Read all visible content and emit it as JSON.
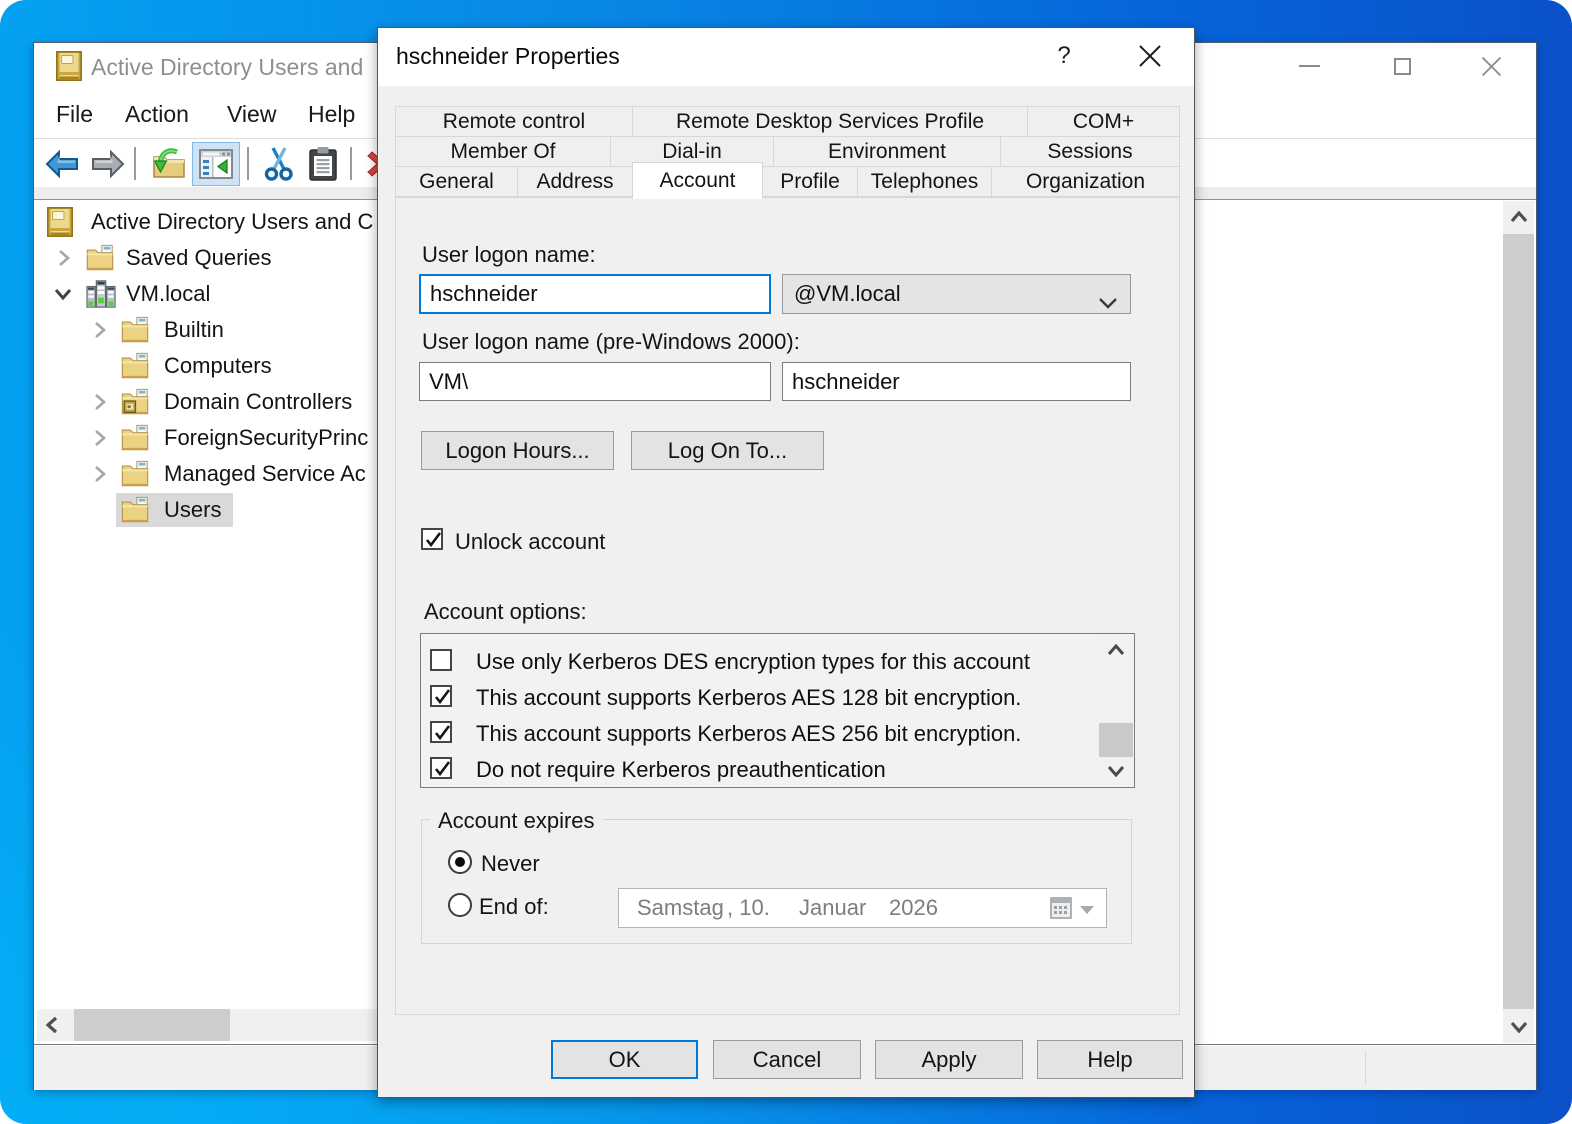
{
  "colors": {
    "desktop_gradient_start": "#16a2ef",
    "desktop_gradient_end": "#0a4ecd",
    "accent_focus_border": "#0078d7",
    "tree_selection": "#d9d9d9",
    "toolbar_toggle_highlight": "#cfe3f6"
  },
  "main_window": {
    "title": "Active Directory Users and",
    "caption_icons": [
      "minimize",
      "maximize",
      "close"
    ],
    "menu_items": [
      "File",
      "Action",
      "View",
      "Help"
    ],
    "toolbar_icon_names": [
      "back",
      "forward",
      "export-list",
      "show-console-tree",
      "cut",
      "paste",
      "delete"
    ],
    "tree": {
      "items": [
        {
          "label": "Active Directory Users and C",
          "level": 0,
          "icon": "directory-book",
          "expander": "none",
          "selected": false
        },
        {
          "label": "Saved Queries",
          "level": 1,
          "icon": "folder",
          "expander": "collapsed",
          "selected": false
        },
        {
          "label": "VM.local",
          "level": 1,
          "icon": "domain",
          "expander": "expanded",
          "selected": false
        },
        {
          "label": "Builtin",
          "level": 2,
          "icon": "folder",
          "expander": "collapsed",
          "selected": false
        },
        {
          "label": "Computers",
          "level": 2,
          "icon": "folder",
          "expander": "none",
          "selected": false
        },
        {
          "label": "Domain Controllers",
          "level": 2,
          "icon": "folder-dc",
          "expander": "collapsed",
          "selected": false
        },
        {
          "label": "ForeignSecurityPrinc",
          "level": 2,
          "icon": "folder",
          "expander": "collapsed",
          "selected": false
        },
        {
          "label": "Managed Service Ac",
          "level": 2,
          "icon": "folder",
          "expander": "collapsed",
          "selected": false
        },
        {
          "label": "Users",
          "level": 2,
          "icon": "folder",
          "expander": "none",
          "selected": true
        }
      ]
    }
  },
  "dialog": {
    "title": "hschneider Properties",
    "titlebar_icons": [
      "help",
      "close"
    ],
    "help_glyph": "?",
    "close_glyph": "✕",
    "tabs": [
      {
        "label": "Remote control",
        "row": 1,
        "active": false
      },
      {
        "label": "Remote Desktop Services Profile",
        "row": 1,
        "active": false
      },
      {
        "label": "COM+",
        "row": 1,
        "active": false
      },
      {
        "label": "Member Of",
        "row": 2,
        "active": false
      },
      {
        "label": "Dial-in",
        "row": 2,
        "active": false
      },
      {
        "label": "Environment",
        "row": 2,
        "active": false
      },
      {
        "label": "Sessions",
        "row": 2,
        "active": false
      },
      {
        "label": "General",
        "row": 3,
        "active": false
      },
      {
        "label": "Address",
        "row": 3,
        "active": false
      },
      {
        "label": "Account",
        "row": 3,
        "active": true
      },
      {
        "label": "Profile",
        "row": 3,
        "active": false
      },
      {
        "label": "Telephones",
        "row": 3,
        "active": false
      },
      {
        "label": "Organization",
        "row": 3,
        "active": false
      }
    ],
    "account_tab": {
      "user_logon_label": "User logon name:",
      "user_logon_value": "hschneider",
      "upn_suffix_value": "@VM.local",
      "pre2000_label": "User logon name (pre-Windows 2000):",
      "pre2000_domain_value": "VM\\",
      "pre2000_name_value": "hschneider",
      "logon_hours_button": "Logon Hours...",
      "log_on_to_button": "Log On To...",
      "unlock_account": {
        "label": "Unlock account",
        "checked": true
      },
      "account_options_label": "Account options:",
      "account_options": [
        {
          "label": "Use only Kerberos DES encryption types for this account",
          "checked": false
        },
        {
          "label": "This account supports Kerberos AES 128 bit encryption.",
          "checked": true
        },
        {
          "label": "This account supports Kerberos AES 256 bit encryption.",
          "checked": true
        },
        {
          "label": "Do not require Kerberos preauthentication",
          "checked": true
        }
      ],
      "account_expires": {
        "group_label": "Account expires",
        "never": {
          "label": "Never",
          "selected": true
        },
        "end_of": {
          "label": "End of:",
          "selected": false
        },
        "date_parts": [
          "Samstag",
          ", 10.",
          "Januar",
          "2026"
        ],
        "date_value": "Samstag, 10. Januar 2026"
      }
    },
    "buttons": [
      "OK",
      "Cancel",
      "Apply",
      "Help"
    ]
  }
}
